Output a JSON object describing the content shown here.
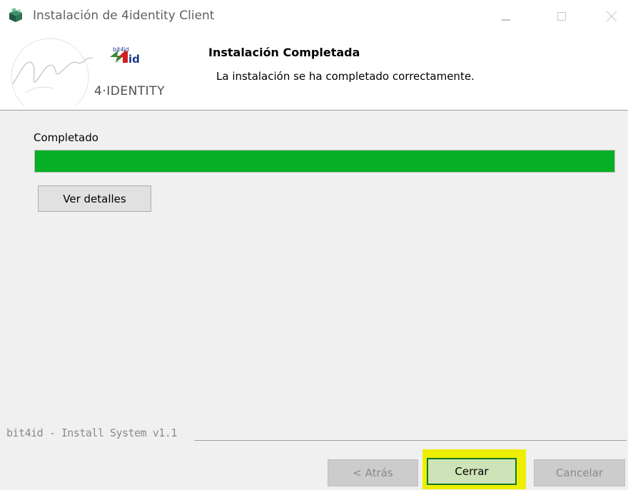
{
  "window": {
    "title": "Instalación de 4identity Client",
    "controls": [
      "minimize-icon",
      "maximize-icon",
      "close-icon"
    ]
  },
  "header": {
    "logo_brand": "bit4id",
    "logo_text": "4·IDENTITY",
    "title": "Instalación Completada",
    "subtitle": "La instalación se ha completado correctamente."
  },
  "main": {
    "status_label": "Completado",
    "progress_fraction": 1.0,
    "details_button": "Ver detalles"
  },
  "footer": {
    "branding": "bit4id - Install System v1.1",
    "back_button": "< Atrás",
    "close_button": "Cerrar",
    "cancel_button": "Cancelar"
  },
  "colors": {
    "progress_fill": "#06b025",
    "highlight": "#eeee00",
    "window_bg": "#f0f0f0"
  }
}
